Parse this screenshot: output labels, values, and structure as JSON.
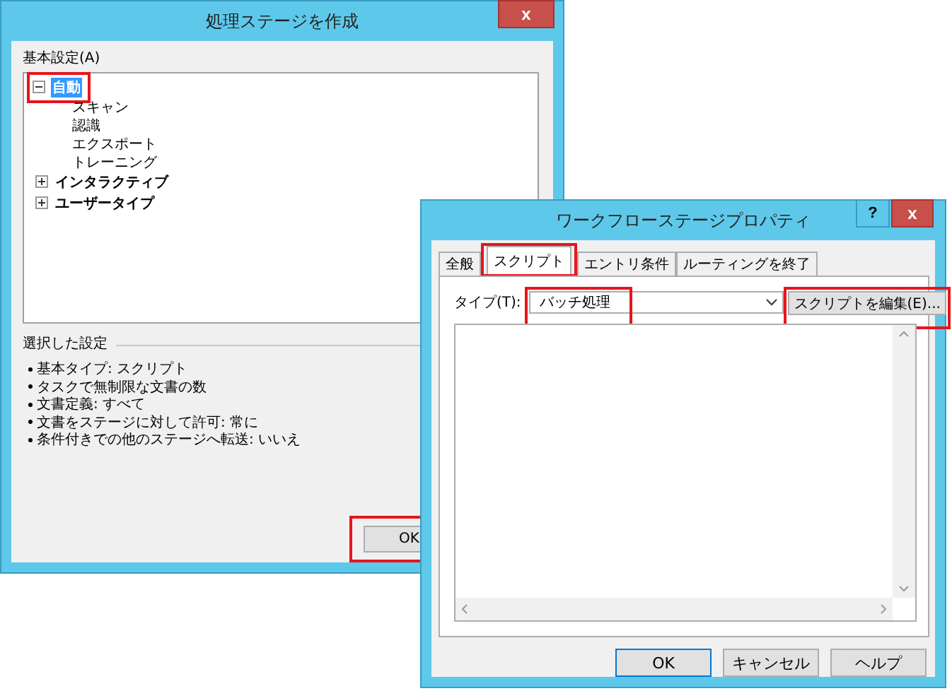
{
  "create_window": {
    "title": "処理ステージを作成",
    "close": "x",
    "tree_label": "基本設定(A)",
    "tree": [
      {
        "label": "自動",
        "expanded": true,
        "selected": true,
        "highlighted": true,
        "children": [
          {
            "label": "スキャン"
          },
          {
            "label": "認識"
          },
          {
            "label": "エクスポート"
          },
          {
            "label": "トレーニング"
          }
        ]
      },
      {
        "label": "インタラクティブ",
        "expanded": false,
        "selected": false,
        "highlighted": false
      },
      {
        "label": "ユーザータイプ",
        "expanded": false,
        "selected": false,
        "highlighted": false
      }
    ],
    "summary_label": "選択した設定",
    "summary": [
      "基本タイプ: スクリプト",
      "タスクで無制限な文書の数",
      "文書定義: すべて",
      "文書をステージに対して許可: 常に",
      "条件付きでの他のステージへ転送: いいえ"
    ],
    "ok_button": {
      "label": "OK",
      "highlighted": true
    }
  },
  "properties_window": {
    "title": "ワークフローステージプロパティ",
    "help": "?",
    "close": "x",
    "tabs": [
      {
        "label": "全般",
        "selected": false,
        "highlighted": false
      },
      {
        "label": "スクリプト",
        "selected": true,
        "highlighted": true
      },
      {
        "label": "エントリ条件",
        "selected": false,
        "highlighted": false
      },
      {
        "label": "ルーティングを終了",
        "selected": false,
        "highlighted": false
      }
    ],
    "type_label": "タイプ(T):",
    "type_value": "バッチ処理",
    "type_highlighted": true,
    "edit_button": {
      "label": "スクリプトを編集(E)...",
      "highlighted": true
    },
    "buttons": [
      {
        "label": "OK",
        "kind": "default"
      },
      {
        "label": "キャンセル",
        "kind": "normal"
      },
      {
        "label": "ヘルプ",
        "kind": "normal"
      }
    ]
  }
}
